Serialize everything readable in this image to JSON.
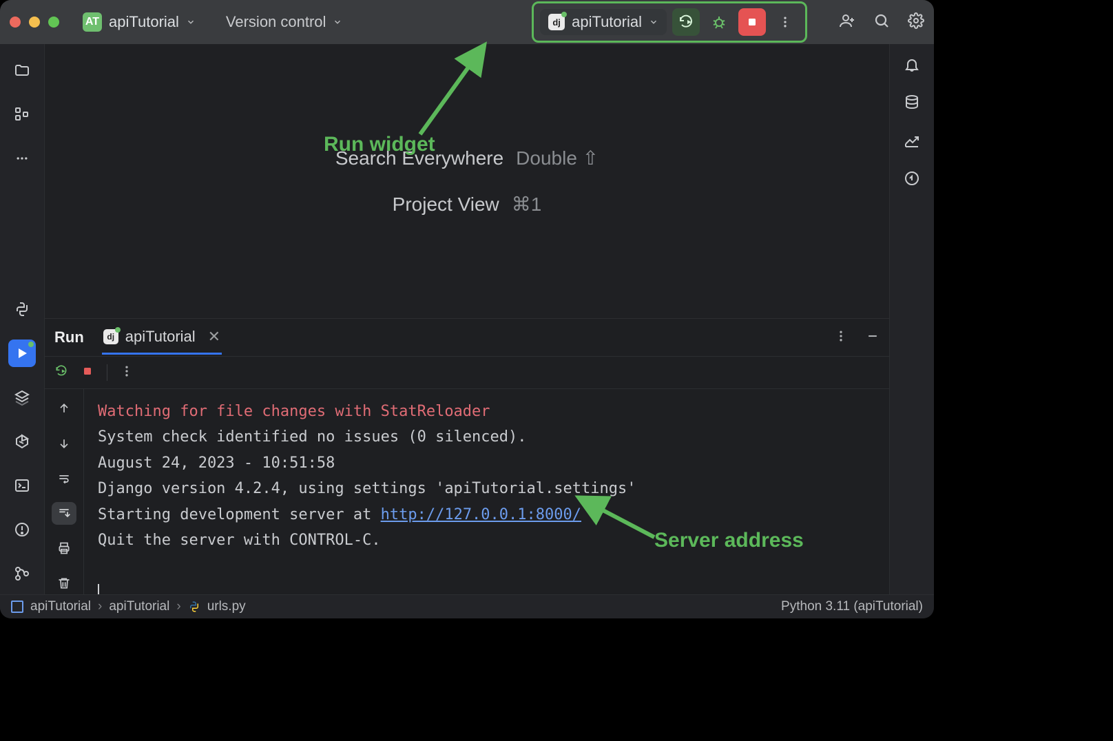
{
  "window": {
    "project_avatar": "AT",
    "project_name": "apiTutorial",
    "vcs_menu": "Version control"
  },
  "run_widget": {
    "config_name": "apiTutorial"
  },
  "welcome": {
    "search_label": "Search Everywhere",
    "search_key": "Double ⇧",
    "project_label": "Project View",
    "project_key": "⌘1"
  },
  "run_tool": {
    "title": "Run",
    "tab": "apiTutorial",
    "lines": {
      "l1": "Watching for file changes with StatReloader",
      "l2": "System check identified no issues (0 silenced).",
      "l3": "August 24, 2023 - 10:51:58",
      "l4a": "Django version 4.2.4, using settings 'apiTutorial.settings'",
      "l5a": "Starting development server at ",
      "l5link": "http://127.0.0.1:8000/",
      "l6": "Quit the server with CONTROL-C."
    }
  },
  "status": {
    "crumb1": "apiTutorial",
    "crumb2": "apiTutorial",
    "crumb3": "urls.py",
    "interpreter": "Python 3.11 (apiTutorial)"
  },
  "annotations": {
    "run_widget": "Run widget",
    "server": "Server address"
  }
}
